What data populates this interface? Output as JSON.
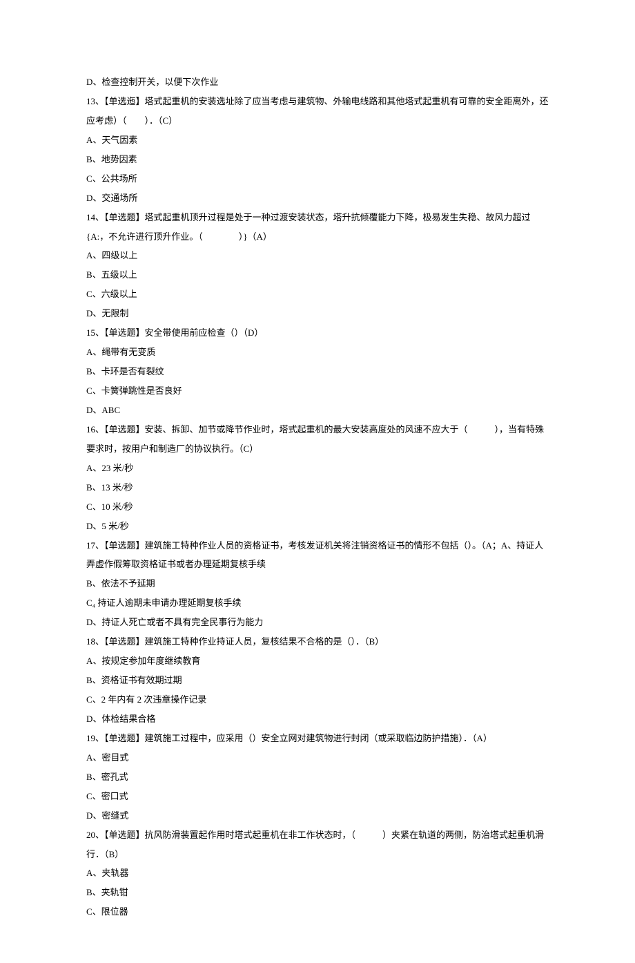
{
  "lines": [
    "D、检查控制开关，以便下次作业",
    "13、【单选迤】塔式起重机的安装选址除了应当考虑与建筑物、外输电线路和其他塔式起重机有可靠的安全距离外，还应考虑）（　　）．（C）",
    "A、天气因素",
    "B、地势因素",
    "C、公共场所",
    "D、交通场所",
    "14、【单选题】塔式起重机顶升过程是处于一种过渡安装状态，塔升抗倾覆能力下降，极易发生失稳、故风力超过{A:，不允许进行顶升作业。（　　　　）}（A）",
    "A、四级以上",
    "B、五级以上",
    "C、六级以上",
    "D、无限制",
    "15、【单选题】安全带使用前应检查（）（D）",
    "A、绳带有无变质",
    "B、卡环是否有裂纹",
    "C、卡簧弹跳性是否良好",
    "D、ABC",
    "16、【单选题】安装、拆卸、加节或降节作业时，塔式起重机的最大安装高度处的风速不应大于（　　　），当有特殊要求时，按用户和制造厂的协议执行。（C）",
    "A、23 米/秒",
    "B、13 米/秒",
    "C、10 米/秒",
    "D、5 米/秒",
    "17、【单选题】建筑施工特种作业人员的资格证书，考核发证机关将注销资格证书的情形不包括（）。（A；A、持证人弄虚作假筹取资格证书或者办理延期复核手续",
    "B、依法不予延期",
    "C₄ 持证人逾期未申请办理延期复核手续",
    "D、持证人死亡或者不具有完全民事行为能力",
    "18、【单选题】建筑施工特种作业持证人员，复核结果不合格的是（）．（B）",
    "A、按规定参加年度继续教育",
    "B、资格证书有效期过期",
    "C、2 年内有 2 次违章操作记录",
    "D、体检结果合格",
    "19、【单选题】建筑施工过程中，应采用（）安全立网对建筑物进行封闭（或采取临边防护措施）．（A）",
    "A、密目式",
    "B、密孔式",
    "C、密口式",
    "D、密缝式",
    "20、【单选题】抗风防滑装置起作用时塔式起重机在非工作状态时，（　　　）夹紧在轨道的两侧，防治塔式起重机滑行．（B）",
    "A、夹轨器",
    "B、夹轨钳",
    "C、限位器"
  ]
}
